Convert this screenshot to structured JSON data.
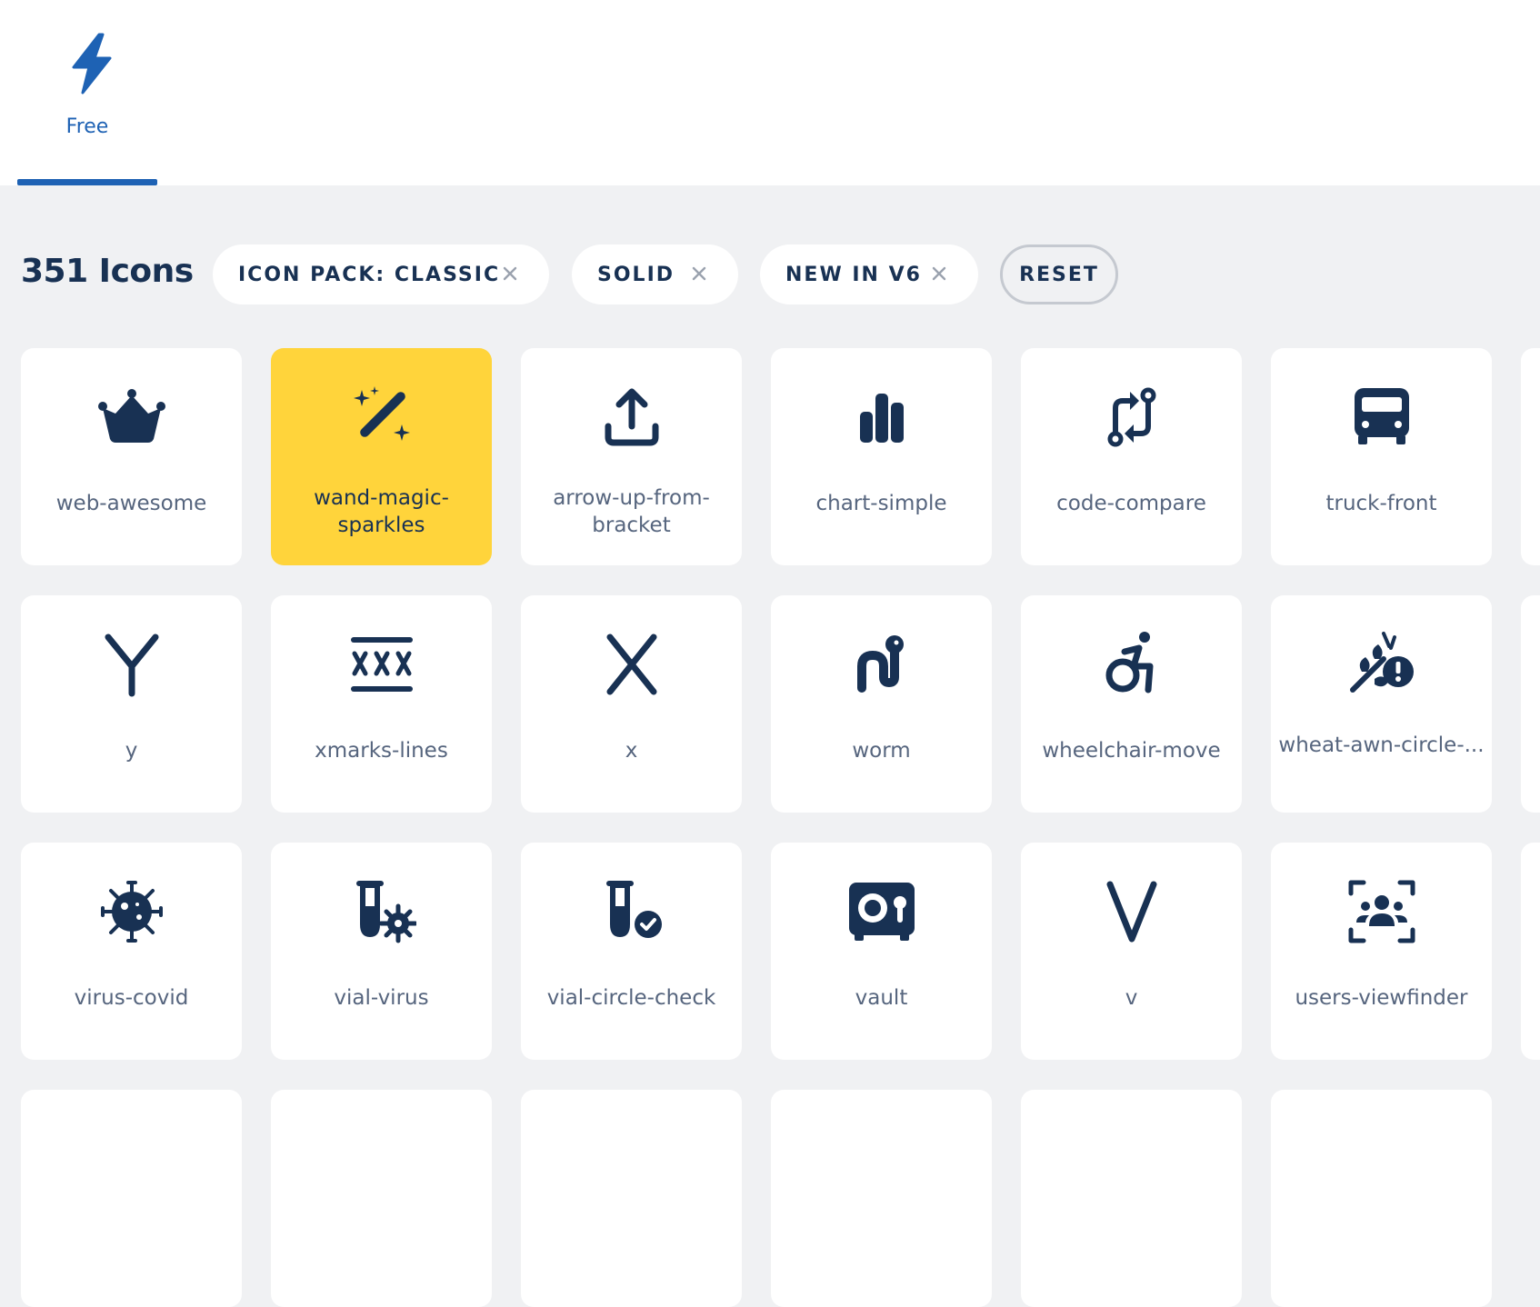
{
  "tabs": [
    {
      "label": "Free",
      "icon": "bolt-icon",
      "active": true
    }
  ],
  "results": {
    "count_label": "351 Icons",
    "filters": [
      {
        "label": "ICON PACK: CLASSIC"
      },
      {
        "label": "SOLID"
      },
      {
        "label": "NEW IN V6"
      }
    ],
    "reset_label": "RESET"
  },
  "icons": [
    {
      "name": "web-awesome",
      "icon": "crown-icon"
    },
    {
      "name": "wand-magic-sparkles",
      "icon": "wand-magic-sparkles-icon",
      "selected": true
    },
    {
      "name": "arrow-up-from-bracket",
      "icon": "arrow-up-from-bracket-icon"
    },
    {
      "name": "chart-simple",
      "icon": "chart-simple-icon"
    },
    {
      "name": "code-compare",
      "icon": "code-compare-icon"
    },
    {
      "name": "truck-front",
      "icon": "truck-front-icon"
    },
    {
      "name": "y",
      "icon": "y-icon"
    },
    {
      "name": "xmarks-lines",
      "icon": "xmarks-lines-icon"
    },
    {
      "name": "x",
      "icon": "x-icon"
    },
    {
      "name": "worm",
      "icon": "worm-icon"
    },
    {
      "name": "wheelchair-move",
      "icon": "wheelchair-move-icon"
    },
    {
      "name": "wheat-awn-circle-...",
      "icon": "wheat-awn-circle-exclamation-icon"
    },
    {
      "name": "virus-covid",
      "icon": "virus-covid-icon"
    },
    {
      "name": "vial-virus",
      "icon": "vial-virus-icon"
    },
    {
      "name": "vial-circle-check",
      "icon": "vial-circle-check-icon"
    },
    {
      "name": "vault",
      "icon": "vault-icon"
    },
    {
      "name": "v",
      "icon": "v-icon"
    },
    {
      "name": "users-viewfinder",
      "icon": "users-viewfinder-icon"
    }
  ],
  "colors": {
    "accent": "#1e62b4",
    "selected": "#ffd43b",
    "ink": "#183153",
    "muted": "#56657e"
  }
}
